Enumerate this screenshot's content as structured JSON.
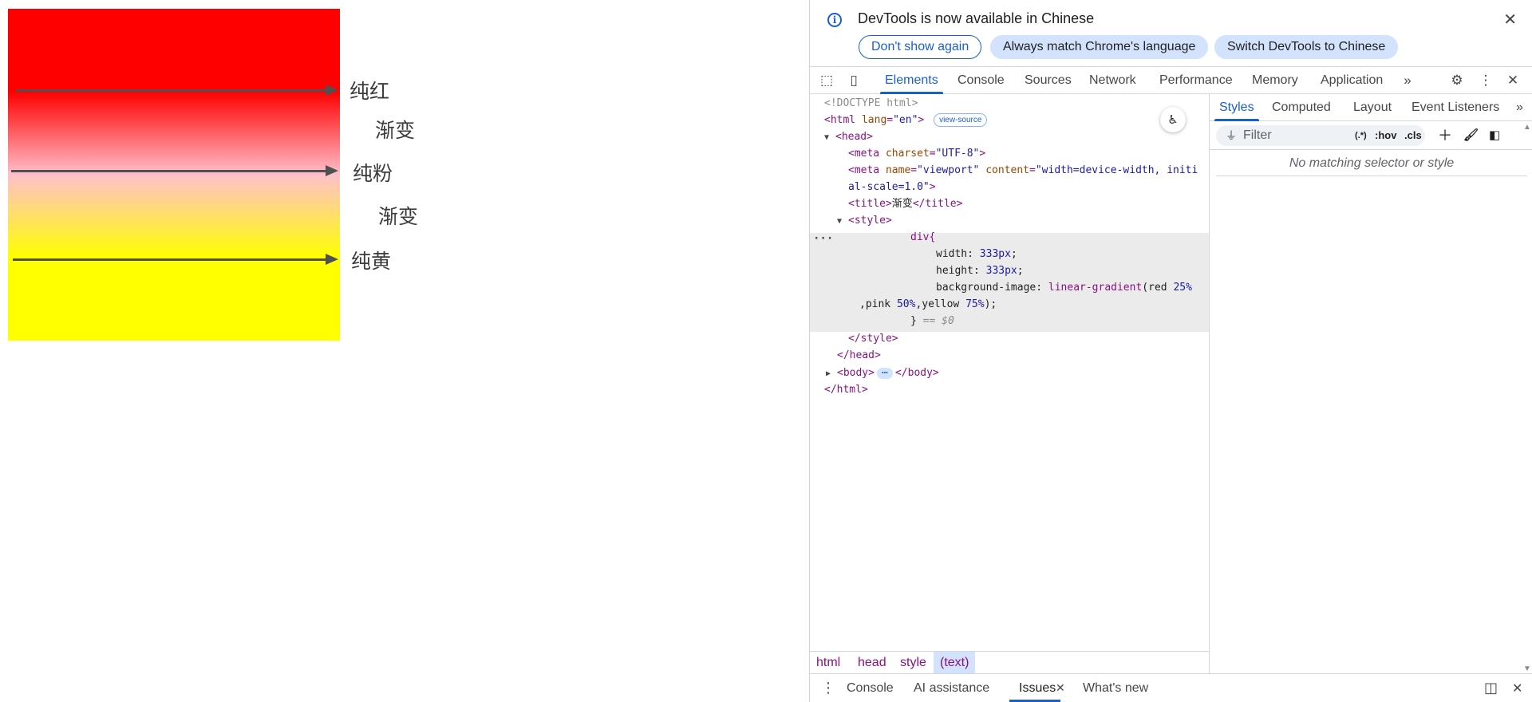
{
  "page": {
    "annotations": [
      "纯红",
      "渐变",
      "纯粉",
      "渐变",
      "纯黄"
    ],
    "gradient_colors": [
      "red",
      "pink",
      "yellow"
    ]
  },
  "infobar": {
    "message": "DevTools is now available in Chinese",
    "dont_show": "Don't show again",
    "match_language": "Always match Chrome's language",
    "switch_language": "Switch DevTools to Chinese"
  },
  "tabs": [
    "Elements",
    "Console",
    "Sources",
    "Network",
    "Performance",
    "Memory",
    "Application"
  ],
  "dom": {
    "doctype": "<!DOCTYPE html>",
    "html_open": "<html",
    "lang_attr": "lang",
    "lang_val": "\"en\"",
    "view_source": "view-source",
    "head_open": "<head>",
    "meta1_tag": "<meta",
    "meta1_attr": "charset",
    "meta1_val": "\"UTF-8\"",
    "meta2_tag": "<meta",
    "meta2_name_attr": "name",
    "meta2_name_val": "\"viewport\"",
    "meta2_content_attr": "content",
    "meta2_content_val_1": "\"width=device-width, initi",
    "meta2_content_val_2": "al-scale=1.0\"",
    "title_open": "<title>",
    "title_text": "渐变",
    "title_close": "</title>",
    "style_open": "<style>",
    "css_selector": "div{",
    "css_width_prop": "width:",
    "css_width_val": "333px",
    "css_height_prop": "height:",
    "css_height_val": "333px",
    "css_bg_prop": "background-image:",
    "css_bg_fn": "linear-gradient",
    "css_bg_red": "red",
    "css_bg_red_stop": "25%",
    "css_bg_pink": ",pink",
    "css_bg_pink_stop": "50%",
    "css_bg_yellow": ",yellow",
    "css_bg_yellow_stop": "75%",
    "css_close": "}",
    "selected_marker": "== $0",
    "style_close": "</style>",
    "head_close": "</head>",
    "body_open": "<body>",
    "body_close": "</body>",
    "html_close": "</html>"
  },
  "breadcrumb": [
    "html",
    "head",
    "style",
    "(text)"
  ],
  "side_tabs": [
    "Styles",
    "Computed",
    "Layout",
    "Event Listeners"
  ],
  "styles": {
    "filter_placeholder": "Filter",
    "regex_toggle": "(.*)",
    "hov": ":hov",
    "cls": ".cls",
    "no_match": "No matching selector or style"
  },
  "drawer": {
    "tabs": [
      "Console",
      "AI assistance",
      "Issues",
      "What's new"
    ]
  },
  "colors": {
    "accent": "#1a5fd0",
    "tag": "#881280",
    "attr": "#994500",
    "value": "#1a1aa6"
  }
}
